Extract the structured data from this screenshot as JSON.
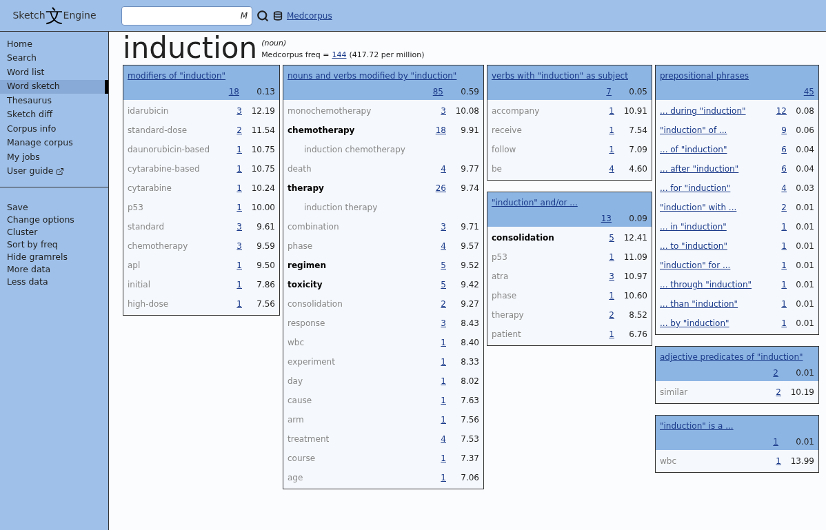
{
  "logo": {
    "left": "Sketch",
    "glyph": "文",
    "right": "Engine"
  },
  "search": {
    "value": "M"
  },
  "corpus_link": "Medcorpus",
  "sidebar": {
    "primary": [
      {
        "label": "Home",
        "selected": false,
        "external": false
      },
      {
        "label": "Search",
        "selected": false,
        "external": false
      },
      {
        "label": "Word list",
        "selected": false,
        "external": false
      },
      {
        "label": "Word sketch",
        "selected": true,
        "external": false
      },
      {
        "label": "Thesaurus",
        "selected": false,
        "external": false
      },
      {
        "label": "Sketch diff",
        "selected": false,
        "external": false
      },
      {
        "label": "Corpus info",
        "selected": false,
        "external": false
      },
      {
        "label": "Manage corpus",
        "selected": false,
        "external": false
      },
      {
        "label": "My jobs",
        "selected": false,
        "external": false
      },
      {
        "label": "User guide",
        "selected": false,
        "external": true
      }
    ],
    "secondary": [
      "Save",
      "Change options",
      "Cluster",
      "Sort by freq",
      "Hide gramrels",
      "More data",
      "Less data"
    ]
  },
  "headword": {
    "word": "induction",
    "pos": "(noun)",
    "freq_label": "Medcorpus freq =",
    "freq": "144",
    "per_million": "(417.72 per million)"
  },
  "columns": [
    [
      {
        "title": "modifiers of \"induction\"",
        "count": "18",
        "score": "0.13",
        "rows": [
          {
            "kind": "word",
            "word": "idarubicin",
            "freq": "3",
            "score": "12.19",
            "bold": false
          },
          {
            "kind": "word",
            "word": "standard-dose",
            "freq": "2",
            "score": "11.54",
            "bold": false
          },
          {
            "kind": "word",
            "word": "daunorubicin-based",
            "freq": "1",
            "score": "10.75",
            "bold": false
          },
          {
            "kind": "word",
            "word": "cytarabine-based",
            "freq": "1",
            "score": "10.75",
            "bold": false
          },
          {
            "kind": "word",
            "word": "cytarabine",
            "freq": "1",
            "score": "10.24",
            "bold": false
          },
          {
            "kind": "word",
            "word": "p53",
            "freq": "1",
            "score": "10.00",
            "bold": false
          },
          {
            "kind": "word",
            "word": "standard",
            "freq": "3",
            "score": "9.61",
            "bold": false
          },
          {
            "kind": "word",
            "word": "chemotherapy",
            "freq": "3",
            "score": "9.59",
            "bold": false
          },
          {
            "kind": "word",
            "word": "apl",
            "freq": "1",
            "score": "9.50",
            "bold": false
          },
          {
            "kind": "word",
            "word": "initial",
            "freq": "1",
            "score": "7.86",
            "bold": false
          },
          {
            "kind": "word",
            "word": "high-dose",
            "freq": "1",
            "score": "7.56",
            "bold": false
          }
        ]
      }
    ],
    [
      {
        "title": "nouns and verbs modified by \"induction\"",
        "count": "85",
        "score": "0.59",
        "rows": [
          {
            "kind": "word",
            "word": "monochemotherapy",
            "freq": "3",
            "score": "10.08",
            "bold": false
          },
          {
            "kind": "word",
            "word": "chemotherapy",
            "freq": "18",
            "score": "9.91",
            "bold": true
          },
          {
            "kind": "phrase",
            "word": "induction chemotherapy"
          },
          {
            "kind": "word",
            "word": "death",
            "freq": "4",
            "score": "9.77",
            "bold": false
          },
          {
            "kind": "word",
            "word": "therapy",
            "freq": "26",
            "score": "9.74",
            "bold": true
          },
          {
            "kind": "phrase",
            "word": "induction therapy"
          },
          {
            "kind": "word",
            "word": "combination",
            "freq": "3",
            "score": "9.71",
            "bold": false
          },
          {
            "kind": "word",
            "word": "phase",
            "freq": "4",
            "score": "9.57",
            "bold": false
          },
          {
            "kind": "word",
            "word": "regimen",
            "freq": "5",
            "score": "9.52",
            "bold": true
          },
          {
            "kind": "word",
            "word": "toxicity",
            "freq": "5",
            "score": "9.42",
            "bold": true
          },
          {
            "kind": "word",
            "word": "consolidation",
            "freq": "2",
            "score": "9.27",
            "bold": false
          },
          {
            "kind": "word",
            "word": "response",
            "freq": "3",
            "score": "8.43",
            "bold": false
          },
          {
            "kind": "word",
            "word": "wbc",
            "freq": "1",
            "score": "8.40",
            "bold": false
          },
          {
            "kind": "word",
            "word": "experiment",
            "freq": "1",
            "score": "8.33",
            "bold": false
          },
          {
            "kind": "word",
            "word": "day",
            "freq": "1",
            "score": "8.02",
            "bold": false
          },
          {
            "kind": "word",
            "word": "cause",
            "freq": "1",
            "score": "7.63",
            "bold": false
          },
          {
            "kind": "word",
            "word": "arm",
            "freq": "1",
            "score": "7.56",
            "bold": false
          },
          {
            "kind": "word",
            "word": "treatment",
            "freq": "4",
            "score": "7.53",
            "bold": false
          },
          {
            "kind": "word",
            "word": "course",
            "freq": "1",
            "score": "7.37",
            "bold": false
          },
          {
            "kind": "word",
            "word": "age",
            "freq": "1",
            "score": "7.06",
            "bold": false
          }
        ]
      }
    ],
    [
      {
        "title": "verbs with \"induction\" as subject",
        "count": "7",
        "score": "0.05",
        "rows": [
          {
            "kind": "word",
            "word": "accompany",
            "freq": "1",
            "score": "10.91",
            "bold": false
          },
          {
            "kind": "word",
            "word": "receive",
            "freq": "1",
            "score": "7.54",
            "bold": false
          },
          {
            "kind": "word",
            "word": "follow",
            "freq": "1",
            "score": "7.09",
            "bold": false
          },
          {
            "kind": "word",
            "word": "be",
            "freq": "4",
            "score": "4.60",
            "bold": false
          }
        ]
      },
      {
        "title": "\"induction\" and/or ...",
        "count": "13",
        "score": "0.09",
        "rows": [
          {
            "kind": "word",
            "word": "consolidation",
            "freq": "5",
            "score": "12.41",
            "bold": true
          },
          {
            "kind": "word",
            "word": "p53",
            "freq": "1",
            "score": "11.09",
            "bold": false
          },
          {
            "kind": "word",
            "word": "atra",
            "freq": "3",
            "score": "10.97",
            "bold": false
          },
          {
            "kind": "word",
            "word": "phase",
            "freq": "1",
            "score": "10.60",
            "bold": false
          },
          {
            "kind": "word",
            "word": "therapy",
            "freq": "2",
            "score": "8.52",
            "bold": false
          },
          {
            "kind": "word",
            "word": "patient",
            "freq": "1",
            "score": "6.76",
            "bold": false
          }
        ]
      }
    ],
    [
      {
        "title": "prepositional phrases",
        "count": "45",
        "rows": [
          {
            "kind": "link",
            "word": "... during \"induction\"",
            "freq": "12",
            "score": "0.08"
          },
          {
            "kind": "link",
            "word": "\"induction\" of ...",
            "freq": "9",
            "score": "0.06"
          },
          {
            "kind": "link",
            "word": "... of \"induction\"",
            "freq": "6",
            "score": "0.04"
          },
          {
            "kind": "link",
            "word": "... after \"induction\"",
            "freq": "6",
            "score": "0.04"
          },
          {
            "kind": "link",
            "word": "... for \"induction\"",
            "freq": "4",
            "score": "0.03"
          },
          {
            "kind": "link",
            "word": "\"induction\" with ...",
            "freq": "2",
            "score": "0.01"
          },
          {
            "kind": "link",
            "word": "... in \"induction\"",
            "freq": "1",
            "score": "0.01"
          },
          {
            "kind": "link",
            "word": "... to \"induction\"",
            "freq": "1",
            "score": "0.01"
          },
          {
            "kind": "link",
            "word": "\"induction\" for ...",
            "freq": "1",
            "score": "0.01"
          },
          {
            "kind": "link",
            "word": "... through \"induction\"",
            "freq": "1",
            "score": "0.01"
          },
          {
            "kind": "link",
            "word": "... than \"induction\"",
            "freq": "1",
            "score": "0.01"
          },
          {
            "kind": "link",
            "word": "... by \"induction\"",
            "freq": "1",
            "score": "0.01"
          }
        ]
      },
      {
        "title": "adjective predicates of \"induction\"",
        "count": "2",
        "score": "0.01",
        "rows": [
          {
            "kind": "word",
            "word": "similar",
            "freq": "2",
            "score": "10.19",
            "bold": false
          }
        ]
      },
      {
        "title": "\"induction\" is a ...",
        "count": "1",
        "score": "0.01",
        "rows": [
          {
            "kind": "word",
            "word": "wbc",
            "freq": "1",
            "score": "13.99",
            "bold": false
          }
        ]
      }
    ]
  ]
}
